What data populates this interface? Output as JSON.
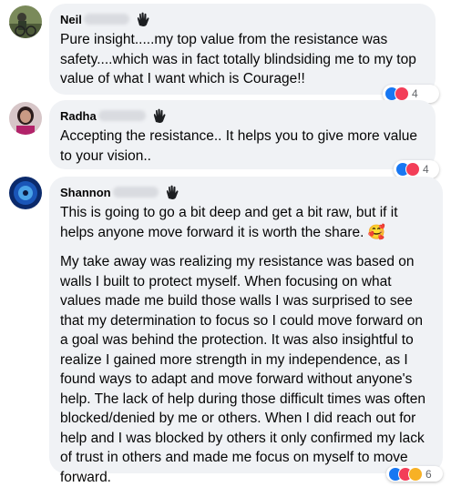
{
  "comments": [
    {
      "name": "Neil",
      "text": "Pure insight.....my top value from the resistance was safety....which was in fact totally blindsiding me to my top value of what I want which is Courage!!",
      "reaction_count": "4",
      "reactions": [
        "like-icon",
        "love-icon"
      ]
    },
    {
      "name": "Radha",
      "text": "Accepting the resistance.. It helps you to give more value to your vision..",
      "reaction_count": "4",
      "reactions": [
        "like-icon",
        "love-icon"
      ]
    },
    {
      "name": "Shannon",
      "text": "This is going to go a bit deep and get a bit raw, but if it helps anyone move forward it is worth the share.",
      "emoji": "🥰",
      "text2": "My take away was realizing my resistance was based on walls I built to protect myself. When focusing on what values made me build those walls I was surprised to see that my determination to focus so I could move forward on a goal was behind the protection. It was also insightful to realize I gained more strength in my independence, as I found ways to adapt and move forward without anyone's help. The lack of help during those difficult times was often blocked/denied by me or others. When I did reach out for help and I was blocked by others it only confirmed my lack of trust in others and made me focus on myself to move forward.",
      "reaction_count": "6",
      "reactions": [
        "like-icon",
        "love-icon",
        "care-icon"
      ]
    }
  ],
  "colors": {
    "bubble": "#f0f2f5",
    "like": "#1877f2",
    "love": "#f33e58",
    "care": "#f7b125"
  }
}
